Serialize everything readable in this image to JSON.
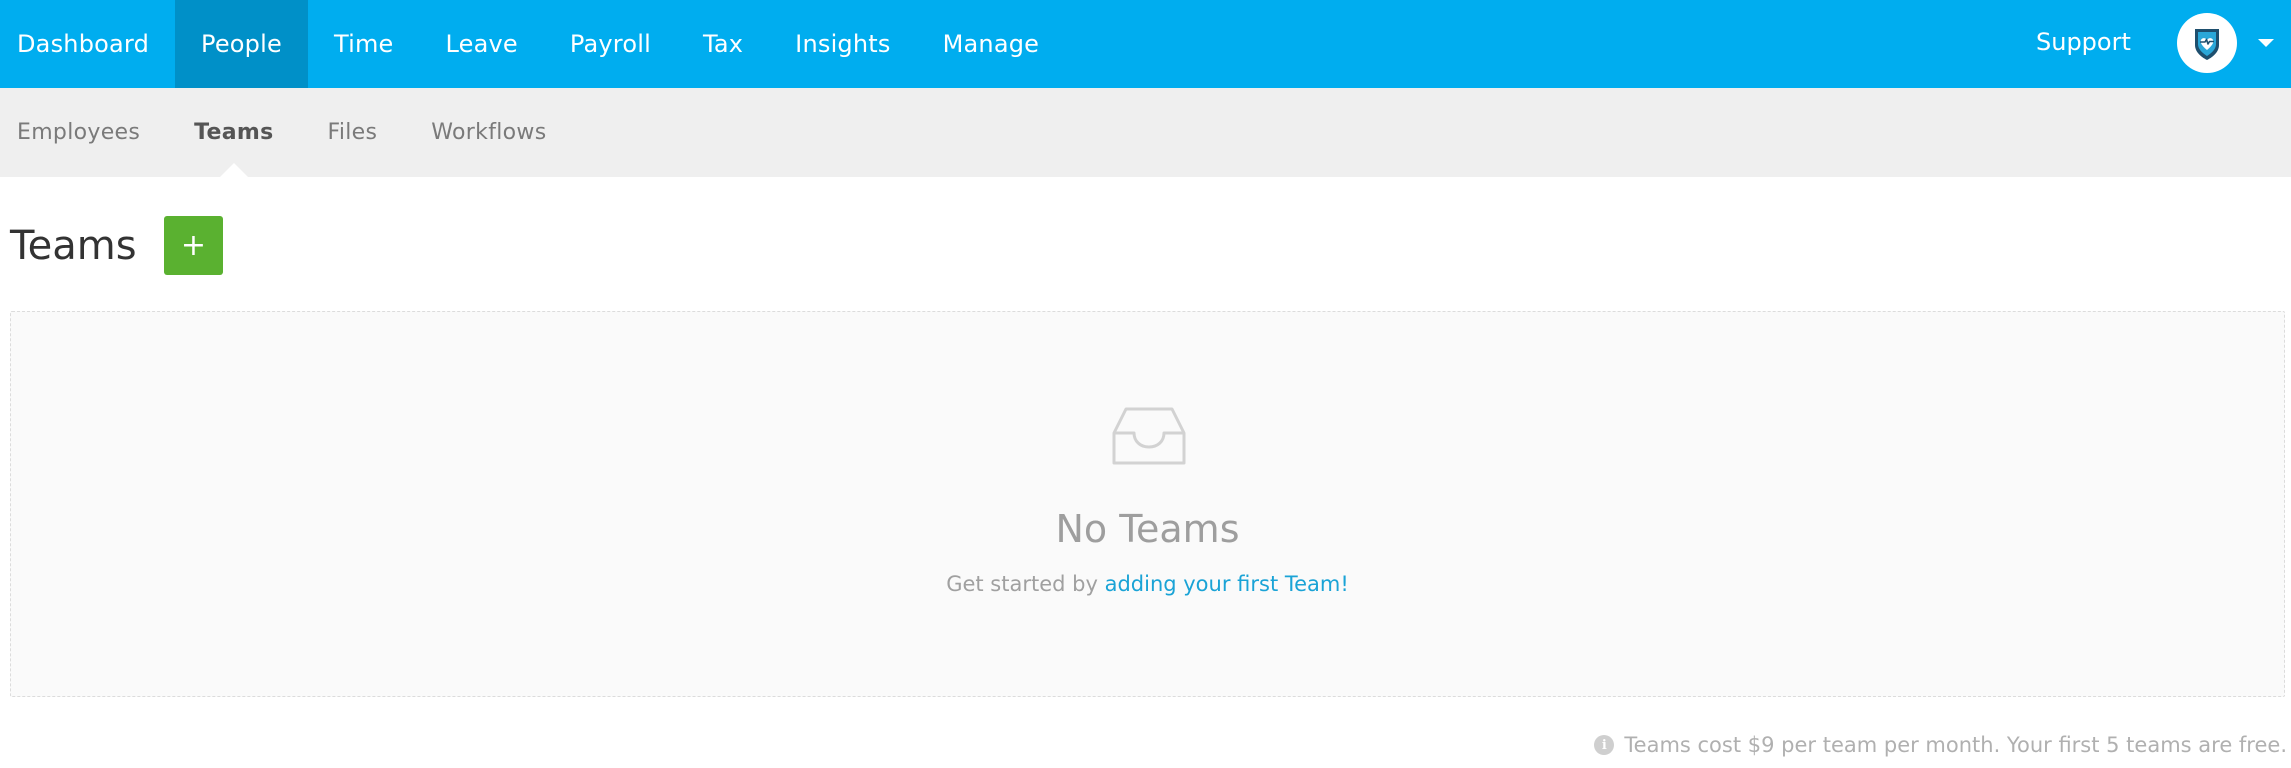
{
  "topnav": {
    "items": [
      {
        "label": "Dashboard",
        "active": false
      },
      {
        "label": "People",
        "active": true
      },
      {
        "label": "Time",
        "active": false
      },
      {
        "label": "Leave",
        "active": false
      },
      {
        "label": "Payroll",
        "active": false
      },
      {
        "label": "Tax",
        "active": false
      },
      {
        "label": "Insights",
        "active": false
      },
      {
        "label": "Manage",
        "active": false
      }
    ],
    "support_label": "Support",
    "avatar_icon": "shield-heart-logo-icon",
    "caret_icon": "caret-down-icon",
    "bg_color": "#00adef",
    "active_bg_color": "#0090c8"
  },
  "subnav": {
    "items": [
      {
        "label": "Employees",
        "active": false
      },
      {
        "label": "Teams",
        "active": true
      },
      {
        "label": "Files",
        "active": false
      },
      {
        "label": "Workflows",
        "active": false
      }
    ]
  },
  "page": {
    "title": "Teams",
    "add_button_label": "+",
    "add_button_color": "#5ab130"
  },
  "empty_state": {
    "icon": "inbox-tray-icon",
    "title": "No Teams",
    "subtitle_prefix": "Get started by ",
    "subtitle_link": "adding your first Team!",
    "link_color": "#1aa3d6"
  },
  "footer": {
    "info_icon": "info-icon",
    "note": "Teams cost $9 per team per month. Your first 5 teams are free."
  }
}
